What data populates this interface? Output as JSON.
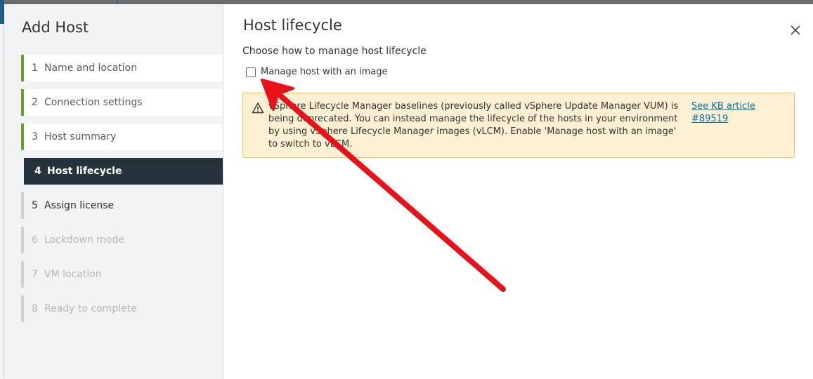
{
  "dialog": {
    "title": "Add Host",
    "close_icon": "close-icon"
  },
  "steps": [
    {
      "number": "1",
      "label": "Name and location",
      "state": "done"
    },
    {
      "number": "2",
      "label": "Connection settings",
      "state": "done"
    },
    {
      "number": "3",
      "label": "Host summary",
      "state": "done"
    },
    {
      "number": "4",
      "label": "Host lifecycle",
      "state": "active"
    },
    {
      "number": "5",
      "label": "Assign license",
      "state": "next"
    },
    {
      "number": "6",
      "label": "Lockdown mode",
      "state": "disabled"
    },
    {
      "number": "7",
      "label": "VM location",
      "state": "disabled"
    },
    {
      "number": "8",
      "label": "Ready to complete",
      "state": "disabled"
    }
  ],
  "page": {
    "title": "Host lifecycle",
    "subtitle": "Choose how to manage host lifecycle",
    "checkbox": {
      "label": "Manage host with an image",
      "checked": false
    }
  },
  "alert": {
    "icon": "warning-icon",
    "text": "vSphere Lifecycle Manager baselines (previously called vSphere Update Manager VUM) is being deprecated. You can instead manage the lifecycle of the hosts in your environment by using vSphere Lifecycle Manager images (vLCM). Enable 'Manage host with an image' to switch to vLCM.",
    "link": "See KB article #89519"
  },
  "colors": {
    "accent_green": "#61a233",
    "active_step_bg": "#25333d",
    "alert_bg": "#fdf0d2",
    "alert_border": "#f0c154",
    "link": "#0072a3",
    "annotation_arrow": "#e8121a"
  }
}
